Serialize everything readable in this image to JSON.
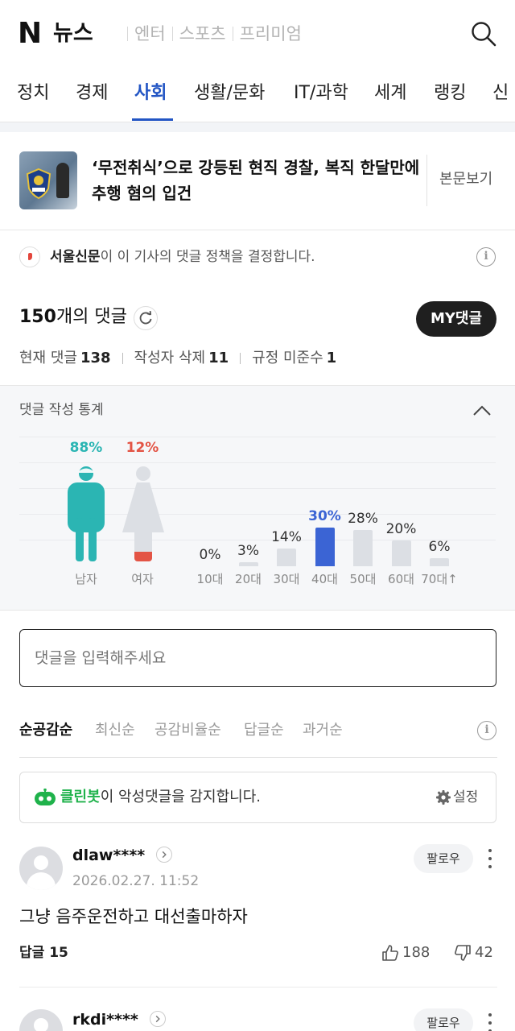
{
  "header": {
    "logo": "N",
    "title": "뉴스",
    "links": [
      "엔터",
      "스포츠",
      "프리미엄"
    ]
  },
  "nav": {
    "tabs": [
      "정치",
      "경제",
      "사회",
      "생활/문화",
      "IT/과학",
      "세계",
      "랭킹",
      "신"
    ],
    "active": "사회"
  },
  "article": {
    "title": "‘무전취식’으로 강등된 현직 경찰, 복직 한달만에 추행 혐의 입건",
    "view_button": "본문보기"
  },
  "policy": {
    "publisher": "서울신문",
    "text": "이 이 기사의 댓글 정책을 결정합니다."
  },
  "comments_header": {
    "count": "150",
    "count_suffix": "개의 댓글",
    "my_button": "MY댓글",
    "current_label": "현재 댓글",
    "current_value": "138",
    "author_deleted_label": "작성자 삭제",
    "author_deleted_value": "11",
    "violation_label": "규정 미준수",
    "violation_value": "1"
  },
  "stats": {
    "title": "댓글 작성 통계",
    "gender": [
      {
        "label": "남자",
        "pct": "88%",
        "value": 88,
        "color": "#2bb5b3"
      },
      {
        "label": "여자",
        "pct": "12%",
        "value": 12,
        "color": "#e35445"
      }
    ],
    "ages": [
      {
        "label": "10대",
        "pct": "0%",
        "value": 0
      },
      {
        "label": "20대",
        "pct": "3%",
        "value": 3
      },
      {
        "label": "30대",
        "pct": "14%",
        "value": 14
      },
      {
        "label": "40대",
        "pct": "30%",
        "value": 30
      },
      {
        "label": "50대",
        "pct": "28%",
        "value": 28
      },
      {
        "label": "60대",
        "pct": "20%",
        "value": 20
      },
      {
        "label": "70대↑",
        "pct": "6%",
        "value": 6
      }
    ]
  },
  "input": {
    "placeholder": "댓글을 입력해주세요"
  },
  "sort": {
    "options": [
      "순공감순",
      "최신순",
      "공감비율순",
      "답글순",
      "과거순"
    ],
    "active": "순공감순"
  },
  "cleanbot": {
    "name": "클린봇",
    "text": "이 악성댓글을 감지합니다.",
    "setting": "설정"
  },
  "comments": [
    {
      "user": "dlaw****",
      "date": "2026.02.27. 11:52",
      "follow": "팔로우",
      "text": "그냥 음주운전하고 대선출마하자",
      "reply": "답글 15",
      "likes": "188",
      "dislikes": "42"
    },
    {
      "user": "rkdi****",
      "follow": "팔로우"
    }
  ]
}
